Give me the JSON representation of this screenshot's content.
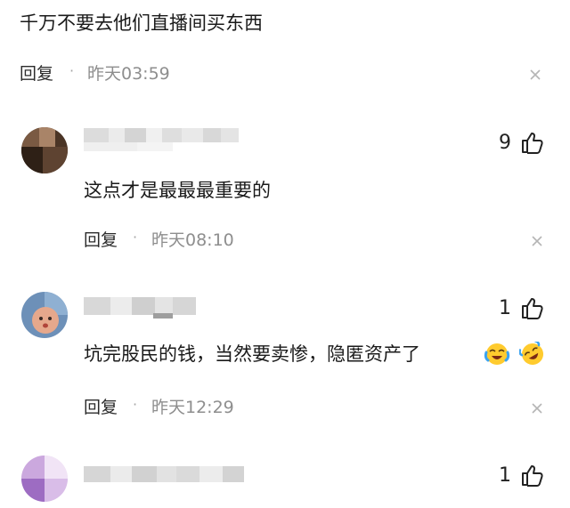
{
  "root_comment": {
    "text": "千万不要去他们直播间买东西",
    "reply_label": "回复",
    "separator": "·",
    "time": "昨天03:59",
    "close_icon": "close-icon"
  },
  "replies": [
    {
      "likes": "9",
      "text": "这点才是最最最重要的",
      "reply_label": "回复",
      "separator": "·",
      "time": "昨天08:10",
      "avatar_colors": [
        "#6b4a35",
        "#3a2a1e",
        "#c9a484"
      ]
    },
    {
      "likes": "1",
      "text": "坑完股民的钱，当然要卖惨，隐匿资产了",
      "emojis": [
        "laughing-crying-emoji",
        "rolling-laughing-emoji"
      ],
      "reply_label": "回复",
      "separator": "·",
      "time": "昨天12:29",
      "avatar_colors": [
        "#5a7fa6",
        "#e8b49a",
        "#ffffff"
      ]
    },
    {
      "likes": "1",
      "avatar_colors": [
        "#b58ad0",
        "#8b5fb0",
        "#e8d6f0"
      ]
    }
  ],
  "colors": {
    "text": "#1a1a1a",
    "meta": "#8e8e8e",
    "blur_light": "#e6e6e6",
    "blur_mid": "#d0d0d0"
  }
}
